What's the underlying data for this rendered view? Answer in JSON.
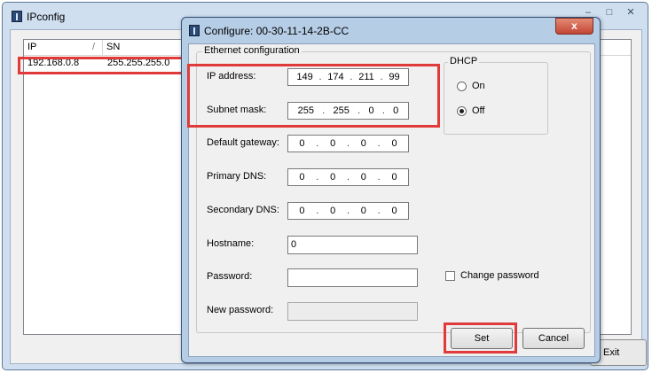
{
  "main_window": {
    "title": "IPconfig",
    "controls": [
      "–",
      "□",
      "✕"
    ],
    "columns": {
      "ip": "IP",
      "sn": "SN",
      "sort_indicator": "/"
    },
    "rows": [
      {
        "ip": "192.168.0.8",
        "sn": "255.255.255.0"
      }
    ],
    "exit_label": "Exit"
  },
  "dialog": {
    "title": "Configure: 00-30-11-14-2B-CC",
    "close_label": "x",
    "ethernet_group_label": "Ethernet configuration",
    "fields": {
      "ip_address": {
        "label": "IP address:",
        "octets": [
          "149",
          "174",
          "211",
          "99"
        ]
      },
      "subnet_mask": {
        "label": "Subnet mask:",
        "octets": [
          "255",
          "255",
          "0",
          "0"
        ]
      },
      "default_gateway": {
        "label": "Default gateway:",
        "octets": [
          "0",
          "0",
          "0",
          "0"
        ]
      },
      "primary_dns": {
        "label": "Primary DNS:",
        "octets": [
          "0",
          "0",
          "0",
          "0"
        ]
      },
      "secondary_dns": {
        "label": "Secondary DNS:",
        "octets": [
          "0",
          "0",
          "0",
          "0"
        ]
      },
      "hostname": {
        "label": "Hostname:",
        "value": "0"
      },
      "password": {
        "label": "Password:",
        "value": ""
      },
      "new_password": {
        "label": "New password:",
        "value": ""
      }
    },
    "dhcp": {
      "label": "DHCP",
      "on": "On",
      "off": "Off",
      "selected": "Off"
    },
    "change_password_label": "Change password",
    "set_label": "Set",
    "cancel_label": "Cancel"
  },
  "colors": {
    "highlight": "#e03a3a",
    "dialog_frame": "#b6cde6",
    "window_frame": "#cfdff0"
  }
}
